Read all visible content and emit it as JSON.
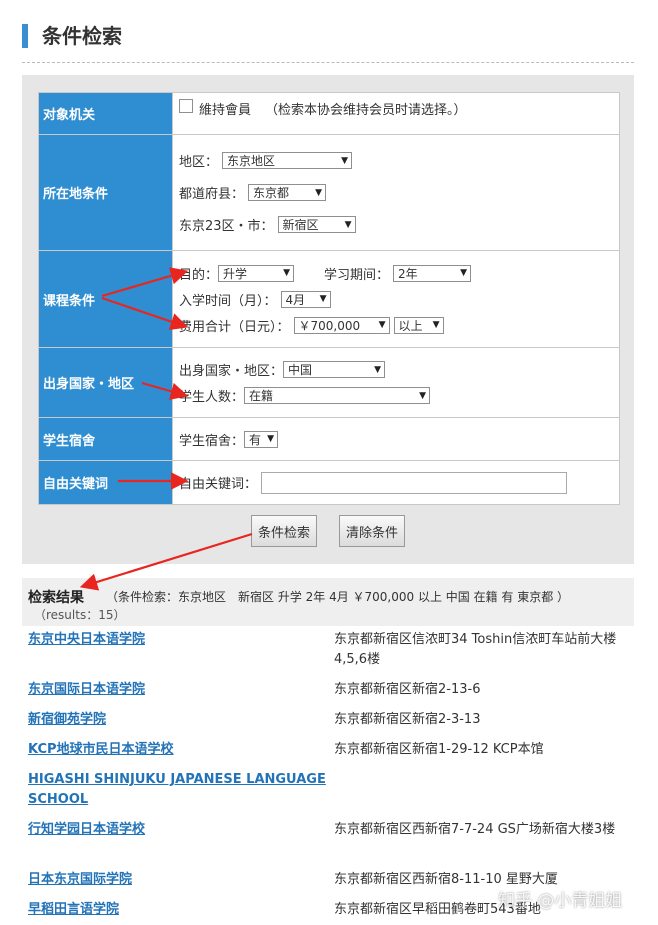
{
  "page": {
    "title": "条件检索"
  },
  "form": {
    "rows": [
      {
        "label": "对象机关",
        "checkbox_label": "維持會員",
        "note": "（检索本协会维持会员时请选择。）"
      },
      {
        "label": "所在地条件",
        "region_label": "地区：",
        "region_value": "东京地区",
        "pref_label": "都道府县：",
        "pref_value": "东京都",
        "city_label": "东京23区・市：",
        "city_value": "新宿区"
      },
      {
        "label": "课程条件",
        "purpose_label": "目的：",
        "purpose_value": "升学",
        "period_label": "学习期间：",
        "period_value": "2年",
        "month_label": "入学时间（月）：",
        "month_value": "4月",
        "fee_label": "费用合计（日元）：",
        "fee_value": "￥700,000",
        "fee_cond": "以上"
      },
      {
        "label": "出身国家・地区",
        "country_label": "出身国家・地区：",
        "country_value": "中国",
        "students_label": "学生人数：",
        "students_value": "在籍"
      },
      {
        "label": "学生宿舍",
        "dorm_label": "学生宿舍：",
        "dorm_value": "有"
      },
      {
        "label": "自由关键词",
        "kw_label": "自由关键词：",
        "kw_value": ""
      }
    ],
    "search_button": "条件检索",
    "clear_button": "清除条件"
  },
  "results": {
    "title": "检索结果",
    "conditions": "（条件检索：东京地区　新宿区  升学  2年  4月  ￥700,000  以上  中国  在籍  有  東京都 ）",
    "count": "（results：15）",
    "items": [
      {
        "name": "东京中央日本语学院",
        "address": "东京都新宿区信浓町34 Toshin信浓町车站前大楼4,5,6楼"
      },
      {
        "name": "东京国际日本语学院",
        "address": "东京都新宿区新宿2-13-6"
      },
      {
        "name": "新宿御苑学院",
        "address": "东京都新宿区新宿2-3-13"
      },
      {
        "name": "KCP地球市民日本语学校",
        "address": "东京都新宿区新宿1-29-12 KCP本馆"
      },
      {
        "name": "HIGASHI SHINJUKU JAPANESE LANGUAGE SCHOOL",
        "address": ""
      },
      {
        "name": "行知学园日本语学校",
        "address": "东京都新宿区西新宿7-7-24 GS广场新宿大楼3楼"
      },
      {
        "name": "日本东京国际学院",
        "address": "东京都新宿区西新宿8-11-10 星野大厦"
      },
      {
        "name": "早稻田言语学院",
        "address": "东京都新宿区早稻田鹤卷町543番地"
      }
    ]
  },
  "watermark": "知乎 @小青姐姐",
  "colors": {
    "label_bg": "#2f8ed2",
    "link": "#2273b8",
    "arrow": "#e8251e",
    "panel": "#e6e6e6"
  }
}
